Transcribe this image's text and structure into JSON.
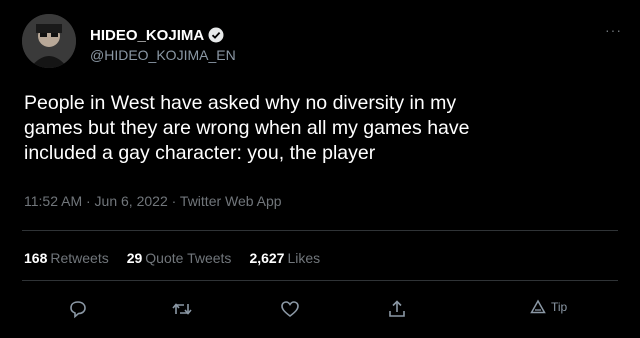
{
  "user": {
    "display_name": "HIDEO_KOJIMA",
    "handle": "@HIDEO_KOJIMA_EN",
    "verified": true
  },
  "more_menu": "···",
  "tweet_text": "People in West have asked why no diversity in my\ngames but they are wrong when all my games have\nincluded a gay character: you, the player",
  "meta": "11:52 AM · Jun 6, 2022 · Twitter Web App",
  "stats": {
    "retweets_count": "168",
    "retweets_label": "Retweets",
    "quotes_count": "29",
    "quotes_label": "Quote Tweets",
    "likes_count": "2,627",
    "likes_label": "Likes"
  },
  "actions": {
    "reply_icon": "reply-icon",
    "retweet_icon": "retweet-icon",
    "like_icon": "like-icon",
    "share_icon": "share-icon",
    "tip_label": "Tip"
  },
  "colors": {
    "background": "#000000",
    "text": "#ffffff",
    "secondary": "#71767b",
    "verified": "#1d9bf0"
  }
}
